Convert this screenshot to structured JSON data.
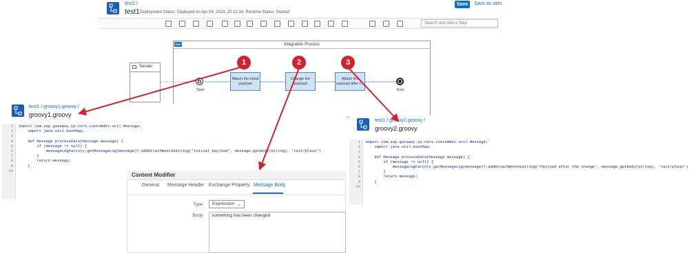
{
  "main_editor": {
    "breadcrumb": "test1 /",
    "title": "test1",
    "status": "Deployment Status: Deployed on Apr 04, 2024, 20:12:34, Runtime Status: Started",
    "save_label": "Save",
    "save_as_label": "Save as vers",
    "search_placeholder": "Search and Add a Step",
    "toolbar_icons": [
      "copy-icon",
      "paste-icon",
      "event-icon",
      "participant-icon",
      "mapping-icon",
      "connector-icon",
      "delete-icon",
      "message-icon",
      "call-icon",
      "route-icon",
      "gateway-icon",
      "transform-icon",
      "security-icon",
      "persist-icon",
      "play-icon",
      "clipboard-icon",
      "help-icon"
    ]
  },
  "process": {
    "pool_title": "Integration Process",
    "sap_badge": "SAP",
    "sender_label": "Sender",
    "start_label": "Start",
    "end_label": "End",
    "steps": [
      {
        "label": "Attach the initial payload"
      },
      {
        "label": "Change the payload"
      },
      {
        "label": "Attach the payload after t..."
      }
    ],
    "badges": [
      "1",
      "2",
      "3"
    ]
  },
  "groovy1": {
    "breadcrumb": "test1 / groovy1.groovy /",
    "title": "groovy1.groovy",
    "line_numbers": [
      "1",
      "2",
      "3",
      "4",
      "5",
      "6",
      "7",
      "8",
      "9",
      "10"
    ],
    "code_lines": [
      "import com.sap.gateway.ip.core.customdev.util.Message;",
      "    import java.util.HashMap;",
      "",
      "    def Message processData(Message message) {",
      "        if (message != null) {",
      "            messageLogFactory.getMessageLog(message)?.addAttachmentAsString('Initial payload', message.getBody(String), 'text/plain')",
      "        }",
      "        return message;",
      "    }",
      ""
    ]
  },
  "groovy2": {
    "breadcrumb": "test1 / groovy2.groovy /",
    "title": "groovy2.groovy",
    "line_numbers": [
      "1",
      "2",
      "3",
      "4",
      "5",
      "6",
      "7",
      "8",
      "9",
      "10"
    ],
    "code_lines": [
      "import com.sap.gateway.ip.core.customdev.util.Message;",
      "    import java.util.HashMap;",
      "",
      "    def Message processData(Message message) {",
      "        if (message != null) {",
      "            messageLogFactory.getMessageLog(message)?.addAttachmentAsString('Payload after the change', message.getBody(String), 'text/plain')",
      "        }",
      "        return message;",
      "    }",
      ""
    ]
  },
  "content_modifier": {
    "title": "Content Modifier",
    "tabs": [
      "General",
      "Message Header",
      "Exchange Property",
      "Message Body"
    ],
    "active_tab": "Message Body",
    "type_label": "Type:",
    "type_value": "Expression",
    "body_label": "Body:",
    "body_value": "something has been changed"
  },
  "colors": {
    "accent": "#0a6ed1",
    "arrow_red": "#d0232b",
    "step_fill": "#cfe2f6",
    "step_border": "#4b86c6"
  }
}
